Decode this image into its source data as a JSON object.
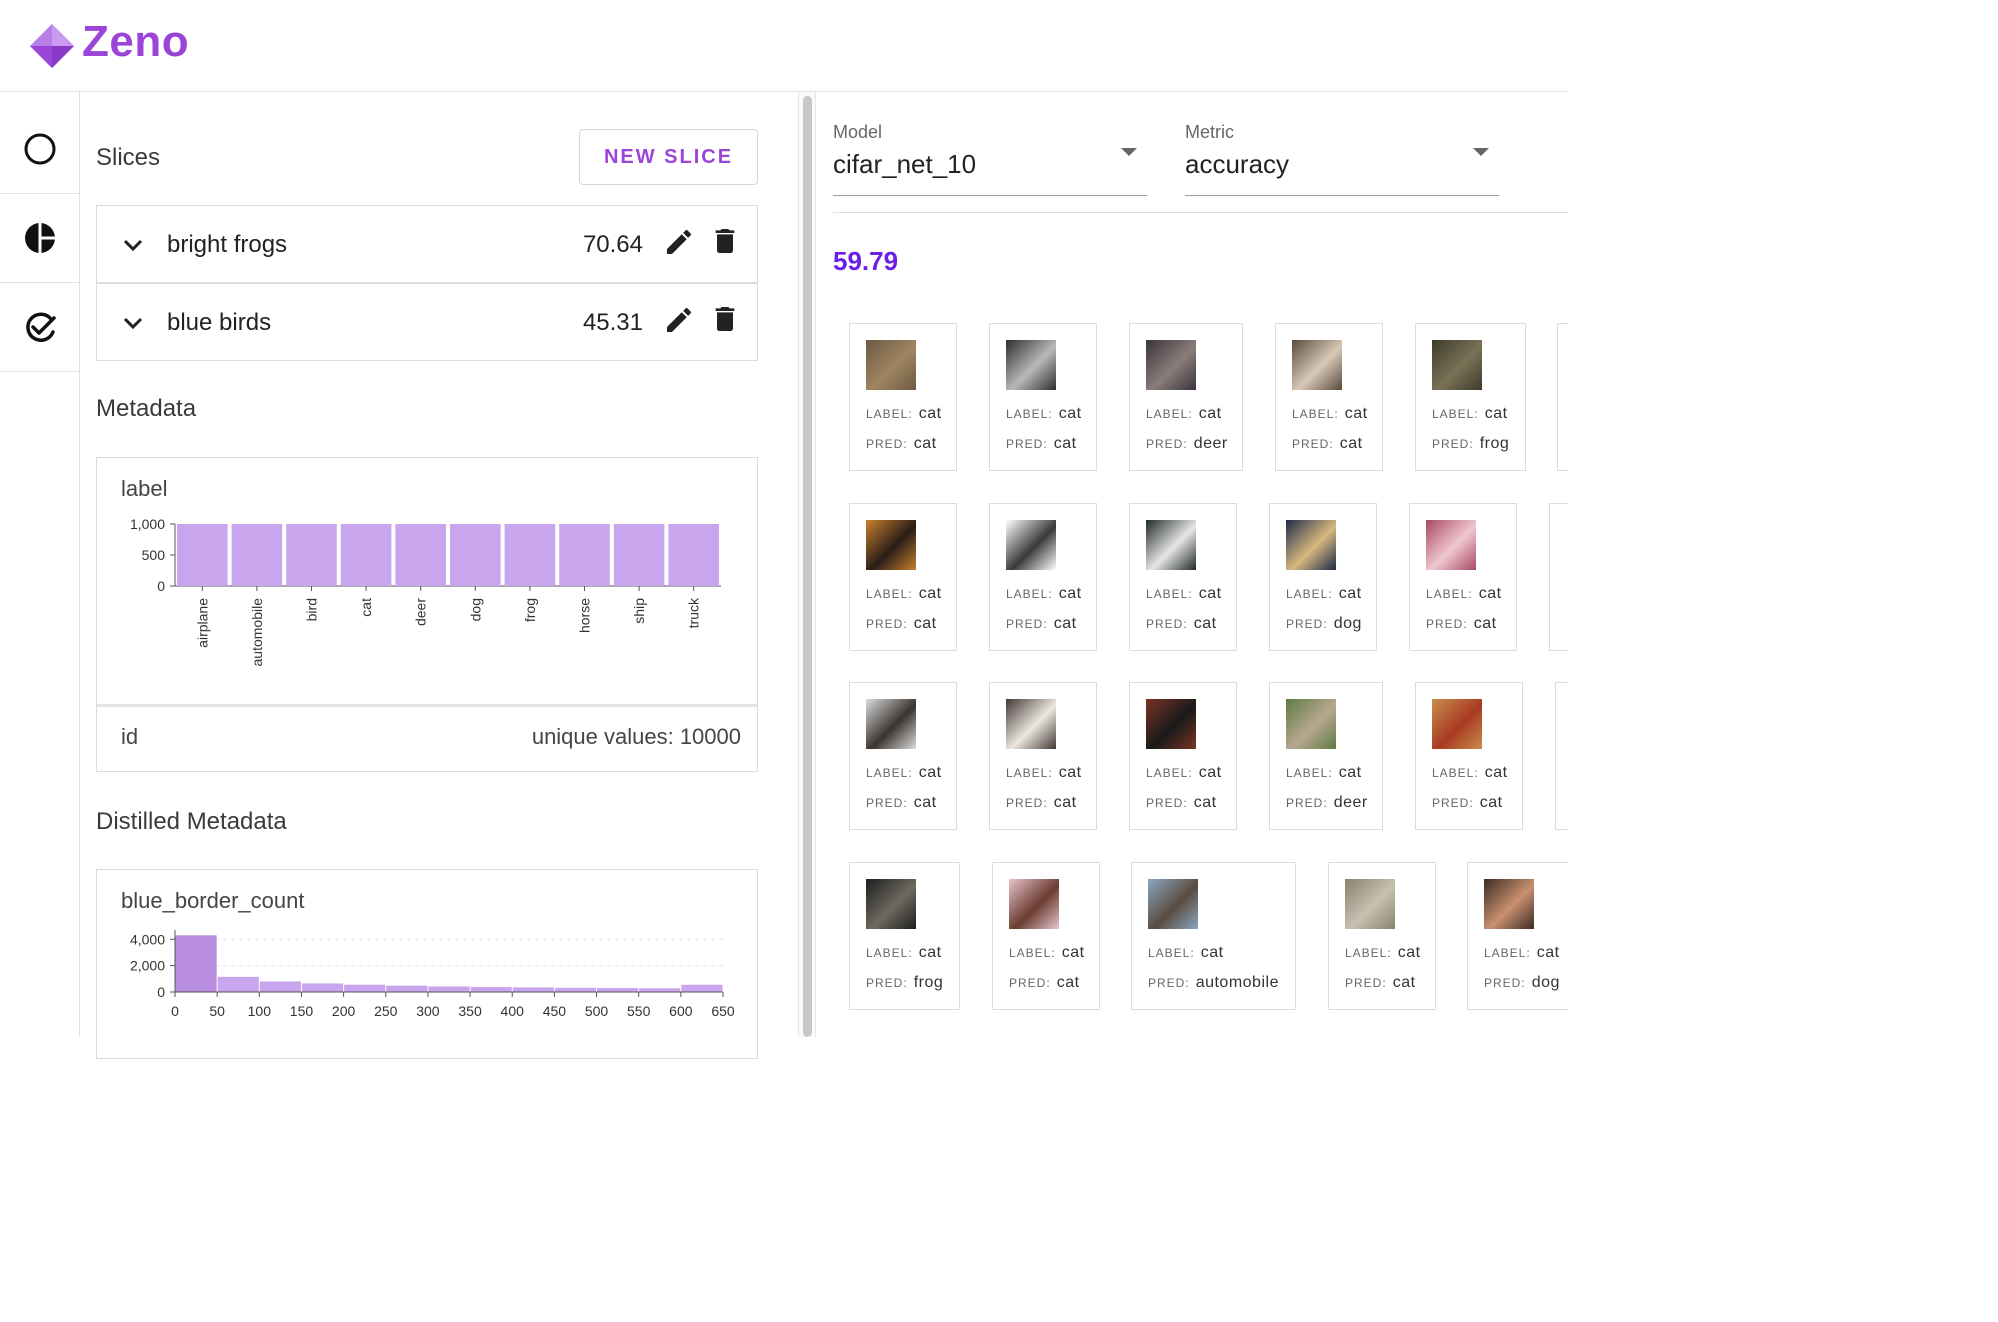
{
  "app": {
    "name": "Zeno"
  },
  "icons": {
    "logo": "zeno-diamond-logo",
    "rail": [
      "circle-icon",
      "pie-chart-icon",
      "check-badge-icon"
    ],
    "expand": "chevron-down-icon",
    "edit": "pencil-icon",
    "delete": "trash-icon"
  },
  "colors": {
    "accent": "#9b45d8",
    "bar": "#c9a5ee",
    "metric": "#6a1ee8"
  },
  "slices": {
    "title": "Slices",
    "new_button": "NEW SLICE",
    "items": [
      {
        "name": "bright frogs",
        "value": "70.64"
      },
      {
        "name": "blue birds",
        "value": "45.31"
      }
    ]
  },
  "metadata": {
    "title": "Metadata",
    "label_column": "label",
    "id_column": "id",
    "id_info": "unique values: 10000"
  },
  "distilled": {
    "title": "Distilled Metadata",
    "column": "blue_border_count"
  },
  "chart_data": [
    {
      "type": "bar",
      "title": "label",
      "categories": [
        "airplane",
        "automobile",
        "bird",
        "cat",
        "deer",
        "dog",
        "frog",
        "horse",
        "ship",
        "truck"
      ],
      "values": [
        1000,
        1000,
        1000,
        1000,
        1000,
        1000,
        1000,
        1000,
        1000,
        1000
      ],
      "yticks": [
        "0",
        "500",
        "1,000"
      ],
      "ylim": [
        0,
        1000
      ],
      "grid": false
    },
    {
      "type": "bar",
      "title": "blue_border_count",
      "bin_edges": [
        0,
        50,
        100,
        150,
        200,
        250,
        300,
        350,
        400,
        450,
        500,
        550,
        600,
        650
      ],
      "values": [
        4300,
        1150,
        800,
        650,
        550,
        480,
        420,
        380,
        350,
        320,
        300,
        280,
        550
      ],
      "xticks": [
        "0",
        "50",
        "100",
        "150",
        "200",
        "250",
        "300",
        "350",
        "400",
        "450",
        "500",
        "550",
        "600",
        "650"
      ],
      "yticks": [
        "0",
        "2,000",
        "4,000"
      ],
      "ylim": [
        0,
        4400
      ],
      "grid": true
    }
  ],
  "controls": {
    "model": {
      "caption": "Model",
      "value": "cifar_net_10"
    },
    "metric": {
      "caption": "Metric",
      "value": "accuracy"
    },
    "metric_value": "59.79"
  },
  "instances": {
    "label_key": "LABEL:",
    "pred_key": "PRED:",
    "items": [
      {
        "label": "cat",
        "pred": "cat",
        "colors": [
          "#6b5a45",
          "#a08560"
        ]
      },
      {
        "label": "cat",
        "pred": "cat",
        "colors": [
          "#2e2e2e",
          "#b8b8b8"
        ]
      },
      {
        "label": "cat",
        "pred": "deer",
        "colors": [
          "#3a3440",
          "#8a7d78"
        ]
      },
      {
        "label": "cat",
        "pred": "cat",
        "colors": [
          "#5a4a3c",
          "#d8c8b8"
        ]
      },
      {
        "label": "cat",
        "pred": "frog",
        "colors": [
          "#3c3a2c",
          "#7a7256"
        ]
      },
      {
        "label": "cat",
        "pred": "cat",
        "colors": [
          "#c9802e",
          "#2a1e18"
        ]
      },
      {
        "label": "cat",
        "pred": "cat",
        "colors": [
          "#ffffff",
          "#3a3a3a"
        ]
      },
      {
        "label": "cat",
        "pred": "cat",
        "colors": [
          "#202a24",
          "#e6e6e6"
        ]
      },
      {
        "label": "cat",
        "pred": "dog",
        "colors": [
          "#1c2a48",
          "#d8b880"
        ]
      },
      {
        "label": "cat",
        "pred": "cat",
        "colors": [
          "#a84864",
          "#f0c8d0"
        ]
      },
      {
        "label": "cat",
        "pred": "cat",
        "colors": [
          "#dcdcdc",
          "#3a3430"
        ]
      },
      {
        "label": "cat",
        "pred": "cat",
        "colors": [
          "#403834",
          "#ece6e0"
        ]
      },
      {
        "label": "cat",
        "pred": "cat",
        "colors": [
          "#7a3426",
          "#1a1a1a"
        ]
      },
      {
        "label": "cat",
        "pred": "deer",
        "colors": [
          "#5e7a44",
          "#b8a890"
        ]
      },
      {
        "label": "cat",
        "pred": "cat",
        "colors": [
          "#c88e4c",
          "#a83a22"
        ]
      },
      {
        "label": "cat",
        "pred": "frog",
        "colors": [
          "#1e1e1e",
          "#6e6a60"
        ]
      },
      {
        "label": "cat",
        "pred": "cat",
        "colors": [
          "#e8c4cc",
          "#6a3c30"
        ]
      },
      {
        "label": "cat",
        "pred": "automobile",
        "colors": [
          "#8aa6c0",
          "#5a4c40"
        ]
      },
      {
        "label": "cat",
        "pred": "cat",
        "colors": [
          "#8a8270",
          "#c8c0b0"
        ]
      },
      {
        "label": "cat",
        "pred": "dog",
        "colors": [
          "#3c2a24",
          "#c89070"
        ]
      }
    ]
  }
}
